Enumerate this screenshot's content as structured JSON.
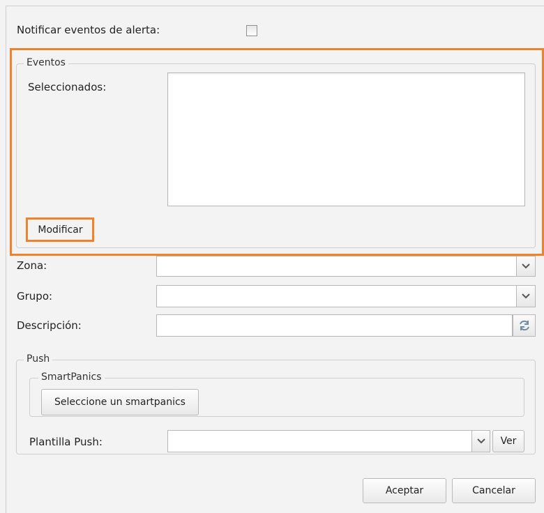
{
  "notify": {
    "label": "Notificar eventos de alerta:",
    "checked": false
  },
  "events": {
    "legend": "Eventos",
    "selected_label": "Seleccionados:",
    "selected_items": [],
    "modify_button": "Modificar"
  },
  "fields": {
    "zona_label": "Zona:",
    "zona_value": "",
    "grupo_label": "Grupo:",
    "grupo_value": "",
    "descripcion_label": "Descripción:",
    "descripcion_value": ""
  },
  "push": {
    "legend": "Push",
    "smartpanics_legend": "SmartPanics",
    "smartpanics_button": "Seleccione un smartpanics",
    "plantilla_label": "Plantilla Push:",
    "plantilla_value": "",
    "ver_button": "Ver"
  },
  "footer": {
    "accept": "Aceptar",
    "cancel": "Cancelar"
  },
  "colors": {
    "highlight": "#f0822c",
    "background": "#f3f3f3"
  },
  "icons": [
    "chevron-down-icon",
    "refresh-icon"
  ]
}
